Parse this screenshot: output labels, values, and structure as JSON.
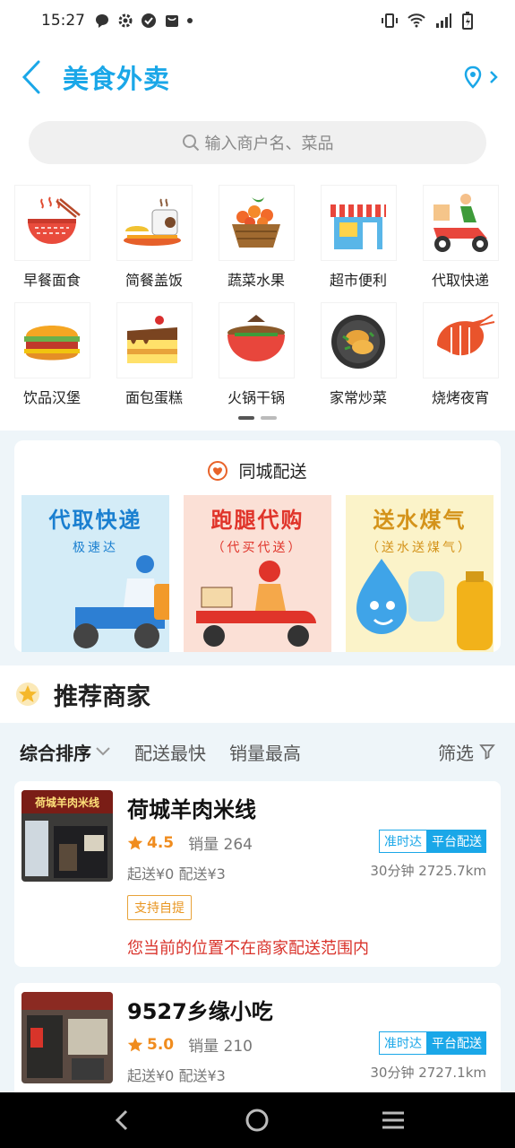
{
  "status_bar": {
    "time": "15:27"
  },
  "header": {
    "title": "美食外卖"
  },
  "search": {
    "placeholder": "输入商户名、菜品"
  },
  "categories": [
    {
      "label": "早餐面食",
      "icon": "noodle-bowl-icon"
    },
    {
      "label": "简餐盖饭",
      "icon": "rice-meal-icon"
    },
    {
      "label": "蔬菜水果",
      "icon": "fruit-basket-icon"
    },
    {
      "label": "超市便利",
      "icon": "store-icon"
    },
    {
      "label": "代取快递",
      "icon": "delivery-scooter-icon"
    },
    {
      "label": "饮品汉堡",
      "icon": "burger-icon"
    },
    {
      "label": "面包蛋糕",
      "icon": "cake-icon"
    },
    {
      "label": "火锅干锅",
      "icon": "hotpot-icon"
    },
    {
      "label": "家常炒菜",
      "icon": "stir-fry-icon"
    },
    {
      "label": "烧烤夜宵",
      "icon": "shrimp-icon"
    }
  ],
  "delivery": {
    "title": "同城配送",
    "banners": [
      {
        "title": "代取快递",
        "subtitle": "极速达"
      },
      {
        "title": "跑腿代购",
        "subtitle": "（代买代送）"
      },
      {
        "title": "送水煤气",
        "subtitle": "（送水送煤气）"
      }
    ]
  },
  "recommend": {
    "title": "推荐商家"
  },
  "sort": {
    "comprehensive": "综合排序",
    "fastest": "配送最快",
    "top_sales": "销量最高",
    "filter": "筛选"
  },
  "shops": [
    {
      "name": "荷城羊肉米线",
      "sign": "荷城羊肉米线",
      "rating": "4.5",
      "sales": "销量 264",
      "fees": "起送¥0  配送¥3",
      "tag_ontime": "准时达",
      "tag_platform": "平台配送",
      "distance": "30分钟 2725.7km",
      "pickup": "支持自提",
      "warning": "您当前的位置不在商家配送范围内"
    },
    {
      "name": "9527乡缘小吃",
      "rating": "5.0",
      "sales": "销量 210",
      "fees": "起送¥0  配送¥3",
      "tag_ontime": "准时达",
      "tag_platform": "平台配送",
      "distance": "30分钟 2727.1km"
    }
  ],
  "colors": {
    "accent": "#1aa7e8",
    "rating": "#f08c1e",
    "warning": "#d9332b"
  }
}
